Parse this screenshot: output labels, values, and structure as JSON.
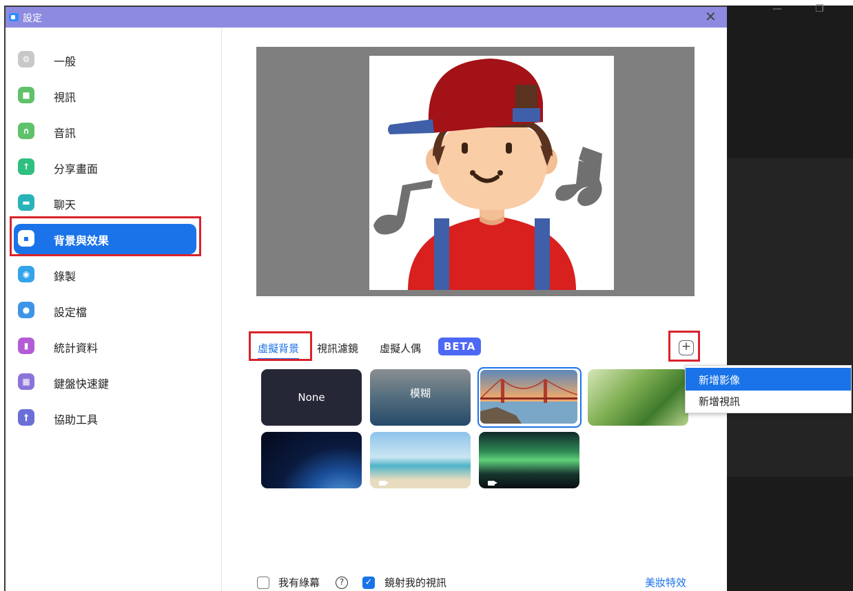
{
  "window": {
    "title": "設定",
    "close_glyph": "✕"
  },
  "titlebar_controls": {
    "minimize": "—",
    "restore": "❐"
  },
  "sidebar": {
    "items": [
      {
        "label": "一般",
        "icon": "gear-icon",
        "color": "#c8c8c8",
        "glyph": "⚙"
      },
      {
        "label": "視訊",
        "icon": "video-camera-icon",
        "color": "#5fc26a",
        "glyph": "■"
      },
      {
        "label": "音訊",
        "icon": "headphones-icon",
        "color": "#5fc26a",
        "glyph": "∩"
      },
      {
        "label": "分享畫面",
        "icon": "share-screen-icon",
        "color": "#2fbf80",
        "glyph": "↑"
      },
      {
        "label": "聊天",
        "icon": "chat-bubble-icon",
        "color": "#29b3b8",
        "glyph": "▬"
      },
      {
        "label": "背景與效果",
        "icon": "background-icon",
        "color": "#ffffff",
        "glyph": "▪"
      },
      {
        "label": "錄製",
        "icon": "record-icon",
        "color": "#34a3ea",
        "glyph": "◉"
      },
      {
        "label": "設定檔",
        "icon": "profile-icon",
        "color": "#3e95e8",
        "glyph": "●"
      },
      {
        "label": "統計資料",
        "icon": "statistics-icon",
        "color": "#b45bd6",
        "glyph": "▮"
      },
      {
        "label": "鍵盤快速鍵",
        "icon": "keyboard-icon",
        "color": "#8b74d9",
        "glyph": "▦"
      },
      {
        "label": "協助工具",
        "icon": "accessibility-icon",
        "color": "#6a6fd8",
        "glyph": "†"
      }
    ],
    "active_index": 5
  },
  "tabs": [
    {
      "label": "虛擬背景"
    },
    {
      "label": "視訊濾鏡"
    },
    {
      "label": "虛擬人偶"
    }
  ],
  "beta_badge": "BETA",
  "add_button": "+",
  "backgrounds": [
    {
      "label": "None",
      "kind": "none"
    },
    {
      "label": "模糊",
      "kind": "blur"
    },
    {
      "label": "",
      "kind": "golden-gate"
    },
    {
      "label": "",
      "kind": "grass"
    },
    {
      "label": "",
      "kind": "earth"
    },
    {
      "label": "",
      "kind": "beach-video"
    },
    {
      "label": "",
      "kind": "aurora-video"
    }
  ],
  "add_menu": {
    "items": [
      "新增影像",
      "新增視訊"
    ],
    "highlighted_index": 0
  },
  "footer": {
    "green_screen_label": "我有綠幕",
    "green_screen_checked": false,
    "help_glyph": "?",
    "mirror_label": "鏡射我的視訊",
    "mirror_checked": true,
    "check_glyph": "✓",
    "beauty_link": "美妝特效"
  },
  "colors": {
    "accent": "#1a73e8",
    "titlebar": "#8d8be0",
    "highlight_box": "#d9232b",
    "beta": "#4d68f5"
  }
}
